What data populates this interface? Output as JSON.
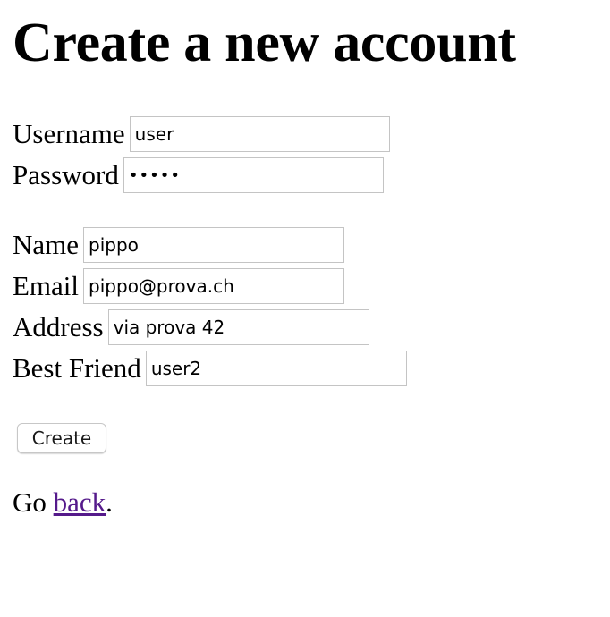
{
  "page": {
    "title": "Create a new account"
  },
  "account": {
    "username_label": "Username",
    "username_value": "user",
    "password_label": "Password",
    "password_value": "•••••"
  },
  "profile": {
    "name_label": "Name",
    "name_value": "pippo",
    "email_label": "Email",
    "email_value": "pippo@prova.ch",
    "address_label": "Address",
    "address_value": "via prova 42",
    "best_friend_label": "Best Friend",
    "best_friend_value": "user2"
  },
  "actions": {
    "create_label": "Create"
  },
  "footer": {
    "prefix": "Go",
    "link_text": "back",
    "suffix": "."
  },
  "colors": {
    "visited_link": "#551a8b",
    "input_border": "#c4c4c4"
  }
}
